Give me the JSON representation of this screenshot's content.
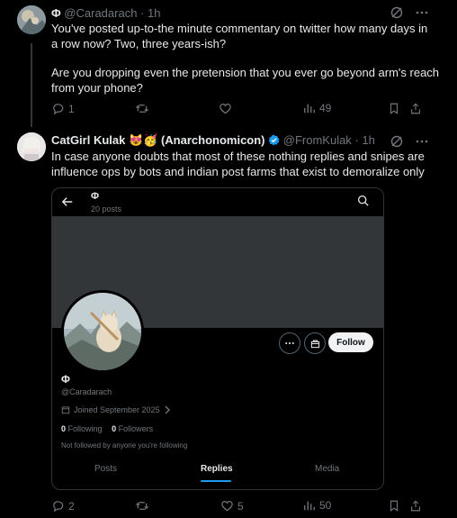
{
  "tweet1": {
    "display_name": "Φ",
    "handle": "@Caradarach",
    "separator": "·",
    "time": "1h",
    "line1": "You've posted up-to-the minute commentary on twitter how many days in",
    "line2": "a row now?  Two, three years-ish?",
    "line3": "Are you dropping even the pretension that you ever go beyond arm's reach",
    "line4": "from your phone?",
    "replies": "1",
    "views": "49"
  },
  "tweet2": {
    "display_name": "CatGirl Kulak 😻🥳 (Anarchonomicon)",
    "handle": "@FromKulak",
    "separator": "·",
    "time": "1h",
    "line1": "In case anyone doubts that most of these nothing replies and snipes are",
    "line2": "influence ops by bots and indian post farms that exist to demoralize only",
    "replies": "2",
    "likes": "5",
    "views": "50"
  },
  "embedded_profile": {
    "name": "Φ",
    "posts_count": "20 posts",
    "follow_label": "Follow",
    "profile_name": "Φ",
    "profile_handle": "@Caradarach",
    "joined": "Joined September 2025",
    "following_count": "0",
    "following_label": "Following",
    "followers_count": "0",
    "followers_label": "Followers",
    "not_followed": "Not followed by anyone you're following",
    "tabs": [
      "Posts",
      "Replies",
      "Media"
    ]
  },
  "colors": {
    "accent": "#1d9bf0",
    "muted": "#71767b",
    "verified": "#1d9bf0"
  }
}
